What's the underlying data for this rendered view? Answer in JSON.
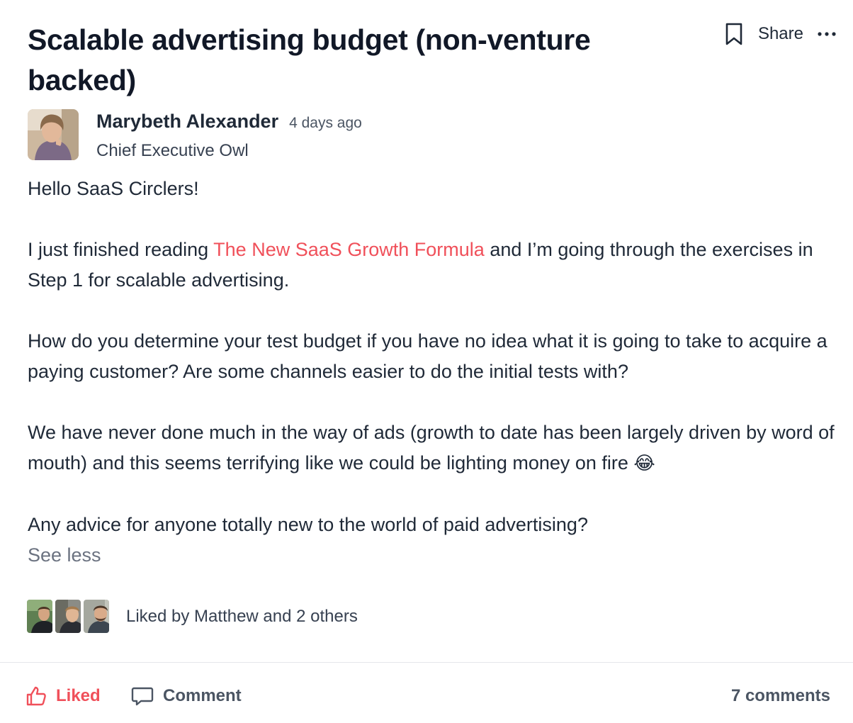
{
  "post": {
    "title": "Scalable advertising budget (non-venture backed)",
    "share_label": "Share"
  },
  "author": {
    "name": "Marybeth Alexander",
    "time": "4 days ago",
    "role": "Chief Executive Owl"
  },
  "body": {
    "greeting": "Hello SaaS Circlers!",
    "p2_before": "I just finished reading ",
    "p2_link": "The New SaaS Growth Formula",
    "p2_after": " and I’m going through the exercises in Step 1 for scalable advertising.",
    "p3": "How do you determine your test budget if you have no idea what it is going to take to acquire a paying customer? Are some channels easier to do the initial tests with?",
    "p4": "We have never done much in the way of ads (growth to date has been largely driven by word of mouth) and this seems terrifying like we could be lighting money on fire ",
    "p4_emoji": "😂",
    "p5": "Any advice for anyone totally new to the world of paid advertising?",
    "see_less": "See less"
  },
  "likes": {
    "text": "Liked by Matthew and 2 others"
  },
  "footer": {
    "liked_label": "Liked",
    "comment_label": "Comment",
    "comments_count": "7 comments"
  },
  "colors": {
    "accent": "#f0505a",
    "text": "#1f2937",
    "muted": "#6b7280"
  },
  "icons": {
    "bookmark": "bookmark-icon",
    "more": "more-horizontal-icon",
    "like": "thumbs-up-icon",
    "comment": "comment-bubble-icon"
  }
}
